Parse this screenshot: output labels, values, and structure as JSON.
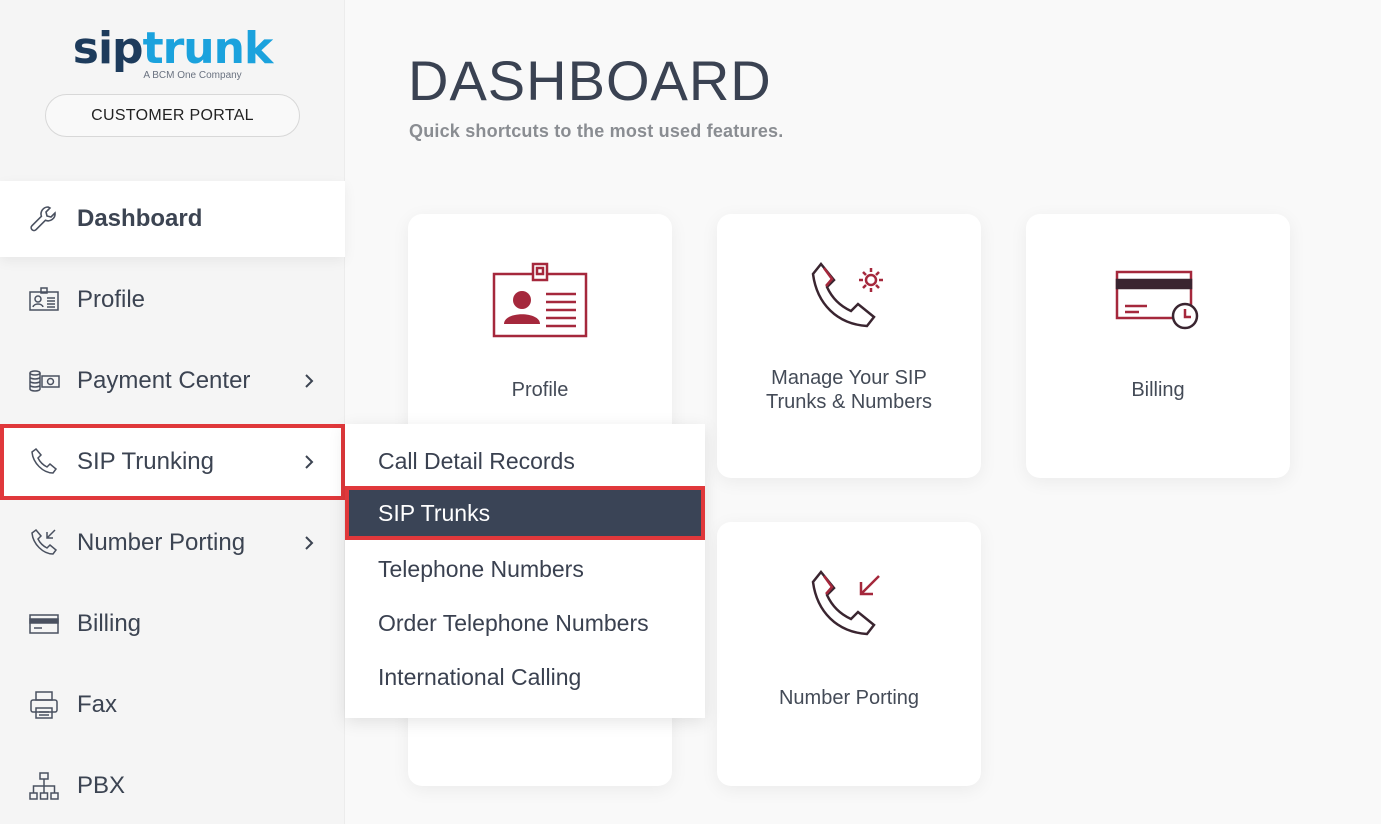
{
  "brand": {
    "logo_part1": "sip",
    "logo_part2": "trunk",
    "tagline": "A BCM One Company",
    "portal_label": "CUSTOMER PORTAL"
  },
  "sidebar": {
    "items": [
      {
        "label": "Dashboard",
        "icon": "wrench-icon"
      },
      {
        "label": "Profile",
        "icon": "id-card-icon"
      },
      {
        "label": "Payment Center",
        "icon": "money-icon"
      },
      {
        "label": "SIP Trunking",
        "icon": "phone-icon"
      },
      {
        "label": "Number Porting",
        "icon": "phone-incoming-icon"
      },
      {
        "label": "Billing",
        "icon": "credit-card-icon"
      },
      {
        "label": "Fax",
        "icon": "printer-icon"
      },
      {
        "label": "PBX",
        "icon": "network-icon"
      }
    ]
  },
  "main": {
    "title": "DASHBOARD",
    "subtitle": "Quick shortcuts to the most used features.",
    "cards": [
      {
        "label": "Profile",
        "icon": "id-badge-icon"
      },
      {
        "label_line1": "Manage Your SIP",
        "label_line2": "Trunks & Numbers",
        "icon": "phone-gear-icon"
      },
      {
        "label": "Billing",
        "icon": "card-history-icon"
      },
      {
        "label": "Number Porting",
        "icon": "phone-incoming-icon"
      }
    ]
  },
  "submenu": {
    "items": [
      "Call Detail Records",
      "SIP Trunks",
      "Telephone Numbers",
      "Order Telephone Numbers",
      "International Calling"
    ]
  },
  "colors": {
    "accent_red": "#a5283c",
    "highlight_outline": "#e0383b",
    "selected_bg": "#3a4456",
    "logo_dark": "#1d3b5c",
    "logo_blue": "#1ba2dd"
  }
}
